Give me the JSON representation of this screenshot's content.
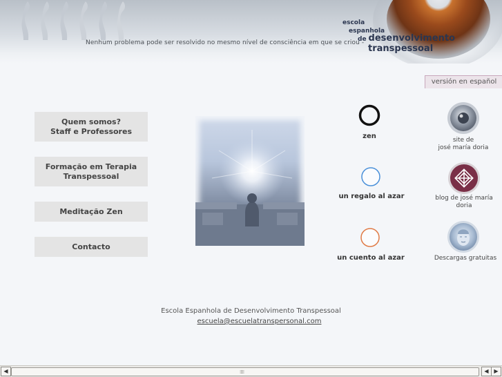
{
  "header": {
    "tagline": "Nenhum problema pode ser resolvido no mesmo nível de consciência em que se criou -",
    "logo": {
      "line1": "escola",
      "line2": "espanhola",
      "line3_prefix": "de",
      "line3": "desenvolvimento",
      "line4": "transpessoal"
    }
  },
  "language_link": "versión en español",
  "nav": {
    "quem_somos": [
      "Quem somos?",
      "Staff e Professores"
    ],
    "formacao": [
      "Formação em Terapia",
      "Transpessoal"
    ],
    "meditacao": "Meditação Zen",
    "contacto": "Contacto"
  },
  "circles": {
    "zen": "zen",
    "regalo": "un regalo al azar",
    "cuento": "un cuento al azar"
  },
  "right_links": {
    "site": [
      "site de",
      "josé maría doria"
    ],
    "blog": [
      "blog de josé maría",
      "doria"
    ],
    "descargas": "Descargas gratuitas"
  },
  "footer": {
    "name": "Escola Espanhola de Desenvolvimento Transpessoal",
    "email": "escuela@escuelatranspersonal.com"
  },
  "icons": {
    "zen": "ensō-circle-icon",
    "regalo": "blue-circle-icon",
    "cuento": "orange-circle-icon",
    "site": "eye-icon",
    "blog": "endless-knot-icon",
    "descargas": "buddha-icon"
  },
  "colors": {
    "page_bg": "#f4f6f9",
    "nav_button": "#e4e4e4",
    "logo_text": "#2b3650",
    "regalo_circle": "#4a90d9",
    "cuento_circle": "#e07a45",
    "language_tab": "#ece4ea"
  }
}
